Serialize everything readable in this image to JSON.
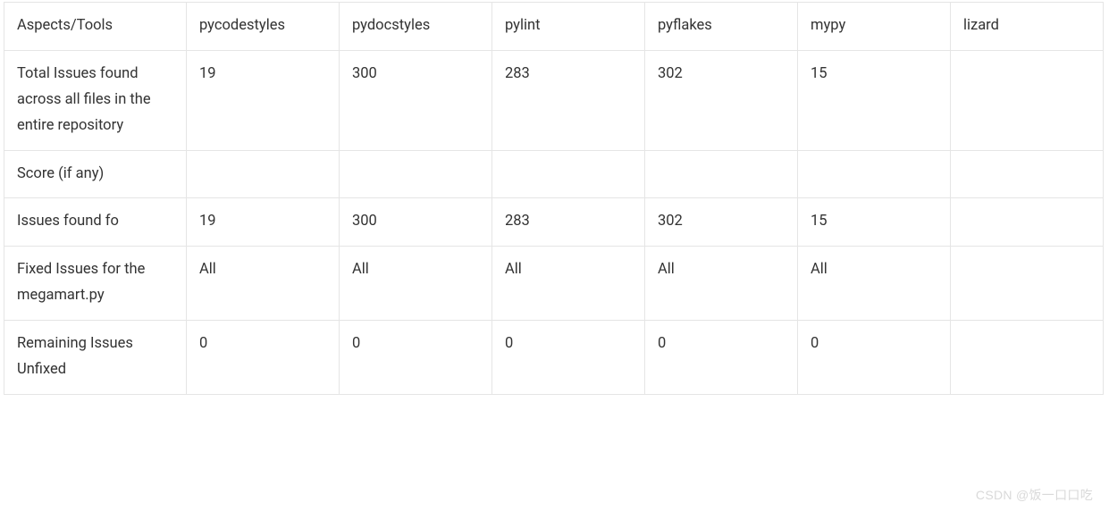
{
  "chart_data": {
    "type": "table",
    "headers": [
      "Aspects/Tools",
      "pycodestyles",
      "pydocstyles",
      "pylint",
      "pyflakes",
      "mypy",
      "lizard"
    ],
    "rows": [
      {
        "label": "Total Issues found across all files in the entire repository",
        "values": [
          "19",
          "300",
          "283",
          "302",
          "15",
          ""
        ]
      },
      {
        "label": "Score (if any)",
        "values": [
          "",
          "",
          "",
          "",
          "",
          ""
        ]
      },
      {
        "label": "Issues found fo",
        "values": [
          "19",
          "300",
          "283",
          "302",
          "15",
          ""
        ]
      },
      {
        "label": "Fixed Issues for the megamart.py",
        "values": [
          "All",
          "All",
          "All",
          "All",
          "All",
          ""
        ]
      },
      {
        "label": "Remaining Issues Unfixed",
        "values": [
          "0",
          "0",
          "0",
          "0",
          "0",
          ""
        ]
      }
    ]
  },
  "watermark": "CSDN @饭一口口吃"
}
